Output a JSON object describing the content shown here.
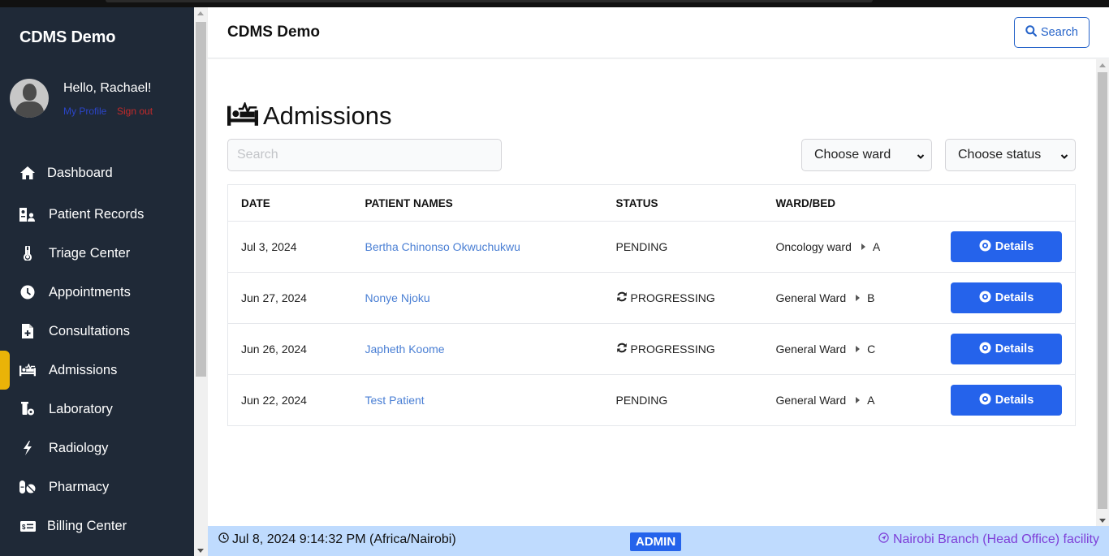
{
  "app": {
    "brand": "CDMS Demo",
    "header_title": "CDMS Demo",
    "search_button_label": "Search"
  },
  "user": {
    "greeting": "Hello, Rachael!",
    "profile_link": "My Profile",
    "signout_link": "Sign out"
  },
  "sidebar": {
    "active": "Admissions",
    "items": [
      {
        "label": "Dashboard",
        "icon": "home-icon"
      },
      {
        "label": "Patient Records",
        "icon": "patient-records-icon"
      },
      {
        "label": "Triage Center",
        "icon": "thermometer-icon"
      },
      {
        "label": "Appointments",
        "icon": "clock-icon"
      },
      {
        "label": "Consultations",
        "icon": "file-medical-icon"
      },
      {
        "label": "Admissions",
        "icon": "bed-pulse-icon"
      },
      {
        "label": "Laboratory",
        "icon": "lab-icon"
      },
      {
        "label": "Radiology",
        "icon": "bolt-icon"
      },
      {
        "label": "Pharmacy",
        "icon": "pills-icon"
      },
      {
        "label": "Billing Center",
        "icon": "money-check-icon"
      }
    ]
  },
  "page": {
    "title": "Admissions",
    "title_icon": "bed-pulse-icon",
    "search_placeholder": "Search",
    "search_value": "",
    "ward_select": "Choose ward",
    "status_select": "Choose status"
  },
  "table": {
    "columns": [
      "DATE",
      "PATIENT NAMES",
      "STATUS",
      "WARD/BED",
      ""
    ],
    "rows": [
      {
        "date": "Jul 3, 2024",
        "patient": "Bertha Chinonso Okwuchukwu",
        "status": "PENDING",
        "status_icon": "",
        "ward": "Oncology ward",
        "bed": "A",
        "action": "Details"
      },
      {
        "date": "Jun 27, 2024",
        "patient": "Nonye Njoku",
        "status": "PROGRESSING",
        "status_icon": "sync-icon",
        "ward": "General Ward",
        "bed": "B",
        "action": "Details"
      },
      {
        "date": "Jun 26, 2024",
        "patient": "Japheth Koome",
        "status": "PROGRESSING",
        "status_icon": "sync-icon",
        "ward": "General Ward",
        "bed": "C",
        "action": "Details"
      },
      {
        "date": "Jun 22, 2024",
        "patient": "Test Patient",
        "status": "PENDING",
        "status_icon": "",
        "ward": "General Ward",
        "bed": "A",
        "action": "Details"
      }
    ]
  },
  "footer": {
    "datetime": "Jul 8, 2024 9:14:32 PM (Africa/Nairobi)",
    "role": "ADMIN",
    "facility": "Nairobi Branch (Head Office) facility"
  },
  "colors": {
    "sidebar_bg": "#1f2937",
    "active_marker": "#eab308",
    "primary": "#2563eb",
    "link": "#4a7fd4",
    "footer_bg": "#bfdbfe",
    "facility_text": "#7e3fd8",
    "signout": "#c52a2a",
    "profile": "#2b45c9"
  }
}
